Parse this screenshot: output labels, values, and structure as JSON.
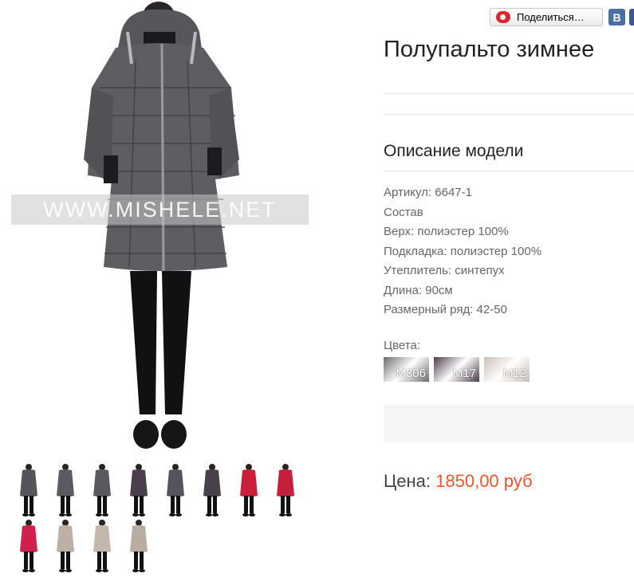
{
  "share": {
    "label": "Поделиться…",
    "vk_label": "В"
  },
  "product": {
    "title": "Полупальто зимнее",
    "watermark": "WWW.MISHELE.NET",
    "description_title": "Описание модели",
    "specs": [
      "Артикул: 6647-1",
      "Состав",
      "Верх: полиэстер 100%",
      "Подкладка: полиэстер 100%",
      "Утеплитель: синтепух",
      "Длина: 90см",
      "Размерный ряд: 42-50"
    ],
    "colors_label": "Цвета:",
    "colors": [
      {
        "code": "M306",
        "color": "#6b6a6e"
      },
      {
        "code": "M17",
        "color": "#4a3b47"
      },
      {
        "code": "M12",
        "color": "#c9bfb6"
      }
    ],
    "price_label": "Цена:",
    "price_value": "1850,00 руб"
  },
  "thumbnails": [
    {
      "color": "#55545a"
    },
    {
      "color": "#5b5a60"
    },
    {
      "color": "#5a5960"
    },
    {
      "color": "#4a3f4a"
    },
    {
      "color": "#55545a"
    },
    {
      "color": "#48404a"
    },
    {
      "color": "#c91f3a"
    },
    {
      "color": "#c41f3d"
    },
    {
      "color": "#cf1f4a"
    },
    {
      "color": "#bdb0a5"
    },
    {
      "color": "#c4b8ad"
    },
    {
      "color": "#b9ada3"
    }
  ],
  "colors": {
    "accent_price": "#f0552b",
    "coat": "#5e5d62"
  }
}
